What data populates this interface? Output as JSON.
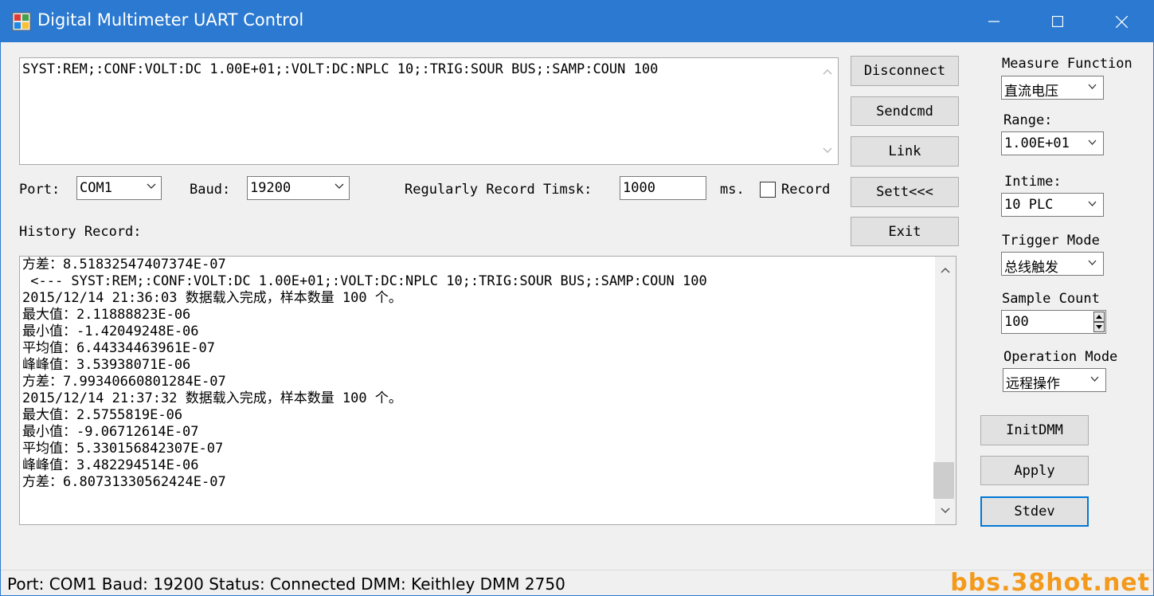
{
  "window": {
    "title": "Digital Multimeter UART Control"
  },
  "command": {
    "text": "SYST:REM;:CONF:VOLT:DC 1.00E+01;:VOLT:DC:NPLC 10;:TRIG:SOUR BUS;:SAMP:COUN 100"
  },
  "conn": {
    "port_label": "Port:",
    "port_value": "COM1",
    "baud_label": "Baud:",
    "baud_value": "19200",
    "timsk_label": "Regularly Record Timsk:",
    "timsk_value": "1000",
    "ms_label": "ms.",
    "record_label": "Record"
  },
  "history": {
    "label": "History Record:",
    "lines": [
      "方差：8.51832547407374E-07",
      " <--- SYST:REM;:CONF:VOLT:DC 1.00E+01;:VOLT:DC:NPLC 10;:TRIG:SOUR BUS;:SAMP:COUN 100",
      "2015/12/14 21:36:03 数据载入完成，样本数量 100 个。",
      "最大值：2.11888823E-06",
      "最小值：-1.42049248E-06",
      "平均值：6.44334463961E-07",
      "峰峰值：3.53938071E-06",
      "方差：7.99340660801284E-07",
      "2015/12/14 21:37:32 数据载入完成，样本数量 100 个。",
      "最大值：2.5755819E-06",
      "最小值：-9.06712614E-07",
      "平均值：5.330156842307E-07",
      "峰峰值：3.482294514E-06",
      "方差：6.80731330562424E-07"
    ]
  },
  "buttons": {
    "disconnect": "Disconnect",
    "sendcmd": "Sendcmd",
    "link": "Link",
    "sett": "Sett<<<",
    "exit": "Exit",
    "initdmm": "InitDMM",
    "apply": "Apply",
    "stdev": "Stdev"
  },
  "settings": {
    "measure_function_label": "Measure Function",
    "measure_function_value": "直流电压",
    "range_label": "Range:",
    "range_value": "1.00E+01",
    "intime_label": "Intime:",
    "intime_value": "10 PLC",
    "trigger_mode_label": "Trigger Mode",
    "trigger_mode_value": "总线触发",
    "sample_count_label": "Sample Count",
    "sample_count_value": "100",
    "operation_mode_label": "Operation Mode",
    "operation_mode_value": "远程操作"
  },
  "status": {
    "text": "Port: COM1  Baud: 19200  Status: Connected  DMM: Keithley DMM 2750"
  },
  "watermark": "bbs.38hot.net",
  "colors": {
    "titlebar": "#2b79d0",
    "focus_border": "#0078d7",
    "watermark": "#f39a1c"
  }
}
